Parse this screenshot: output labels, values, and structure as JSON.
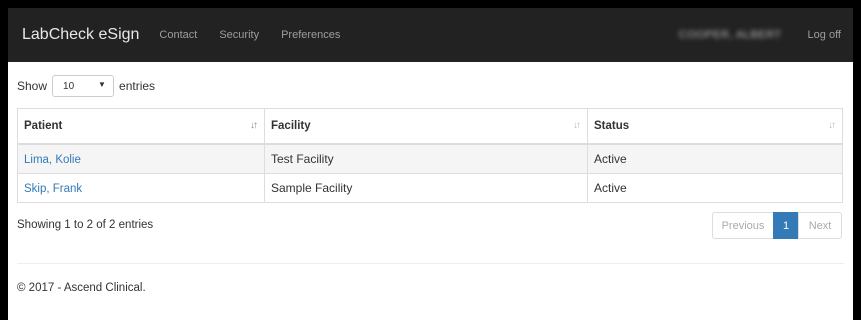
{
  "navbar": {
    "brand": "LabCheck eSign",
    "links": [
      "Contact",
      "Security",
      "Preferences"
    ],
    "user": "COOPER, ALBERT",
    "logoff": "Log off"
  },
  "length": {
    "prefix": "Show",
    "value": "10",
    "suffix": "entries"
  },
  "table": {
    "headers": [
      "Patient",
      "Facility",
      "Status"
    ],
    "rows": [
      [
        "Lima, Kolie",
        "Test Facility",
        "Active"
      ],
      [
        "Skip, Frank",
        "Sample Facility",
        "Active"
      ]
    ]
  },
  "info": "Showing 1 to 2 of 2 entries",
  "pagination": {
    "previous": "Previous",
    "current": "1",
    "next": "Next"
  },
  "footer": "© 2017 - Ascend Clinical."
}
